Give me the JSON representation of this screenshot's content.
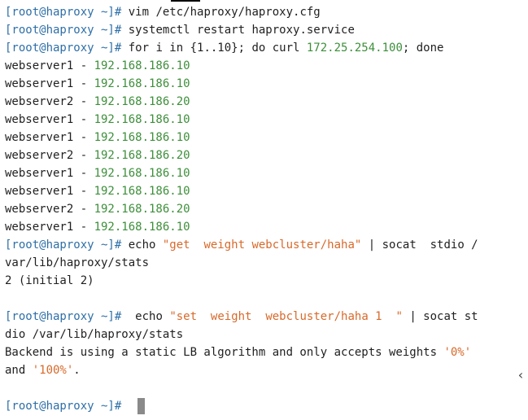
{
  "terminal": {
    "prompt": "[root@haproxy ~]#",
    "commands": {
      "c1": " vim /etc/haproxy/haproxy.cfg",
      "c2": " systemctl restart haproxy.service",
      "c3_pre": " for i in {1..10}; do curl ",
      "c3_ip": "172.25.254.100",
      "c3_post": "; done",
      "c4_pre": " echo ",
      "c4_str": "\"get  weight webcluster/haha\"",
      "c4_post": " | socat  stdio /",
      "c4_wrap": "var/lib/haproxy/stats",
      "c5_pre": "  echo ",
      "c5_str": "\"set  weight  webcluster/haha 1  \"",
      "c5_post": " | socat st",
      "c5_wrap": "dio /var/lib/haproxy/stats"
    },
    "curl_output": [
      {
        "host": "webserver1 - ",
        "ip": "192.168.186.10"
      },
      {
        "host": "webserver1 - ",
        "ip": "192.168.186.10"
      },
      {
        "host": "webserver2 - ",
        "ip": "192.168.186.20"
      },
      {
        "host": "webserver1 - ",
        "ip": "192.168.186.10"
      },
      {
        "host": "webserver1 - ",
        "ip": "192.168.186.10"
      },
      {
        "host": "webserver2 - ",
        "ip": "192.168.186.20"
      },
      {
        "host": "webserver1 - ",
        "ip": "192.168.186.10"
      },
      {
        "host": "webserver1 - ",
        "ip": "192.168.186.10"
      },
      {
        "host": "webserver2 - ",
        "ip": "192.168.186.20"
      },
      {
        "host": "webserver1 - ",
        "ip": "192.168.186.10"
      }
    ],
    "weight_output": "2 (initial 2)",
    "error_output": {
      "l1_pre": "Backend is using a static LB algorithm and only accepts weights ",
      "l1_val": "'0%'",
      "l2_pre": "and ",
      "l2_val": "'100%'",
      "l2_post": "."
    },
    "scroll_icon": "chevron-left-icon",
    "colors": {
      "prompt": "#2e6fa7",
      "ip_green": "#3d8f3a",
      "string_orange": "#d8692a",
      "text": "#1f1f1f"
    }
  }
}
